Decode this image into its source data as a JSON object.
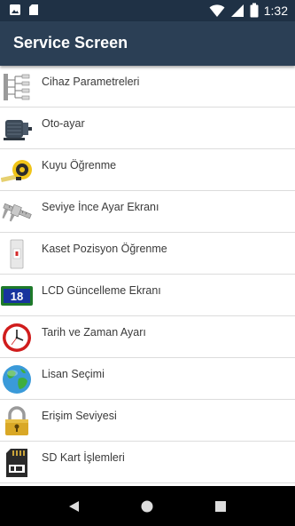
{
  "status_bar": {
    "time": "1:32",
    "left_icons": [
      "image-icon",
      "sd-card-icon"
    ],
    "right_icons": [
      "wifi-icon",
      "signal-icon",
      "battery-icon"
    ]
  },
  "app_bar": {
    "title": "Service Screen"
  },
  "menu": {
    "items": [
      {
        "label": "Cihaz Parametreleri",
        "icon": "tree-hierarchy-icon"
      },
      {
        "label": "Oto-ayar",
        "icon": "motor-icon"
      },
      {
        "label": "Kuyu Öğrenme",
        "icon": "tape-measure-icon"
      },
      {
        "label": "Seviye İnce Ayar Ekranı",
        "icon": "caliper-icon"
      },
      {
        "label": "Kaset Pozisyon Öğrenme",
        "icon": "cassette-icon"
      },
      {
        "label": "LCD Güncelleme Ekranı",
        "icon": "lcd-display-icon"
      },
      {
        "label": "Tarih ve Zaman Ayarı",
        "icon": "clock-icon"
      },
      {
        "label": "Lisan Seçimi",
        "icon": "globe-icon"
      },
      {
        "label": "Erişim Seviyesi",
        "icon": "padlock-icon"
      },
      {
        "label": "SD Kart İşlemleri",
        "icon": "sd-card-icon"
      }
    ],
    "lcd_icon_text": "18"
  },
  "nav_bar": {
    "buttons": [
      "back-icon",
      "home-icon",
      "recents-icon"
    ]
  }
}
